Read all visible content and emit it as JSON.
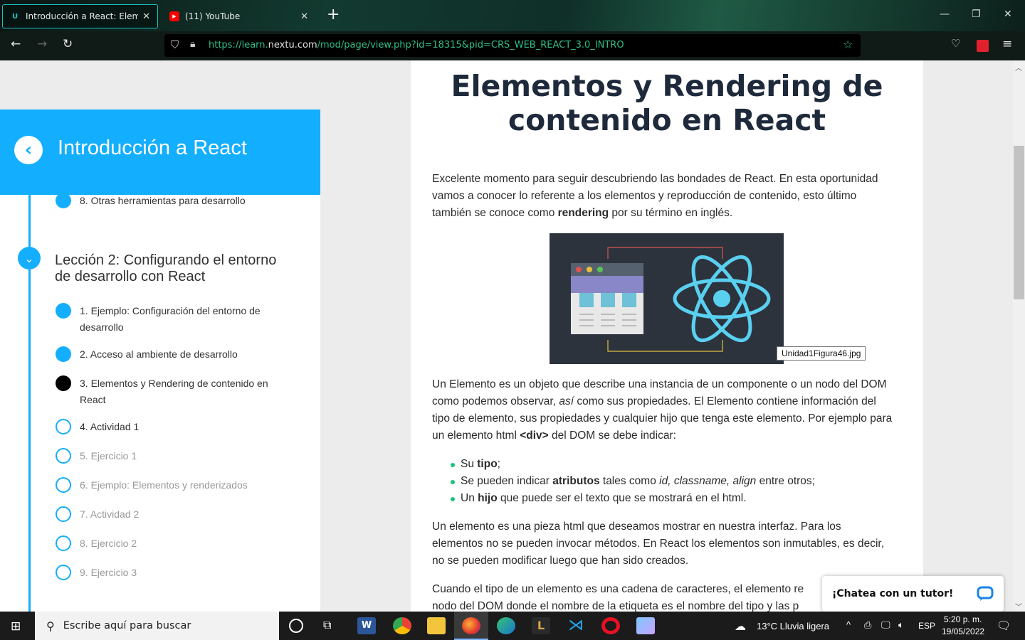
{
  "browser": {
    "tabs": [
      {
        "title": "Introducción a React: Elementos y",
        "favicon": "nextu-icon",
        "active": true
      },
      {
        "title": "(11) YouTube",
        "favicon": "youtube-icon",
        "active": false
      }
    ],
    "url_prefix": "https://learn.",
    "url_domain": "nextu.com",
    "url_path": "/mod/page/view.php?id=18315&pid=CRS_WEB_REACT_3.0_INTRO"
  },
  "sidebar": {
    "title": "Introducción a React",
    "prev_item": "8. Otras herramientas para desarrollo",
    "lesson_title": "Lección 2: Configurando el entorno de desarrollo con React",
    "items": [
      {
        "label": "1. Ejemplo: Configuración del entorno de desarrollo",
        "state": "done"
      },
      {
        "label": "2. Acceso al ambiente de desarrollo",
        "state": "done"
      },
      {
        "label": "3. Elementos y Rendering de contenido en React",
        "state": "current"
      },
      {
        "label": "4. Actividad 1",
        "state": "open"
      },
      {
        "label": "5. Ejercicio 1",
        "state": "locked"
      },
      {
        "label": "6. Ejemplo: Elementos y renderizados",
        "state": "locked"
      },
      {
        "label": "7. Actividad 2",
        "state": "locked"
      },
      {
        "label": "8. Ejercicio 2",
        "state": "locked"
      },
      {
        "label": "9. Ejercicio 3",
        "state": "locked"
      }
    ]
  },
  "content": {
    "title": "Elementos y Rendering de contenido en React",
    "p1a": "Excelente momento para seguir descubriendo las bondades de React. En esta oportunidad vamos a conocer lo referente a los elementos y reproducción de contenido, esto último también se conoce como ",
    "p1b": "rendering",
    "p1c": " por su término en inglés.",
    "figure_tooltip": "Unidad1Figura46.jpg",
    "p2a": "Un Elemento es un objeto que describe una instancia de un componente o un nodo del DOM como podemos observar, ",
    "p2b": "así",
    "p2c": " como sus propiedades. El Elemento contiene información del tipo de elemento, sus propiedades y cualquier hijo que tenga este elemento. Por ejemplo para un elemento html ",
    "p2d": "<div>",
    "p2e": " del DOM se debe indicar:",
    "b1a": "Su ",
    "b1b": "tipo",
    "b1c": ";",
    "b2a": "Se pueden indicar ",
    "b2b": "atributos",
    "b2c": " tales como ",
    "b2d": "id, classname, align",
    "b2e": " entre otros;",
    "b3a": "Un ",
    "b3b": "hijo",
    "b3c": " que puede ser el texto que se mostrará en el html.",
    "p3": "Un elemento es una pieza html  que deseamos mostrar en nuestra interfaz. Para los elementos no se pueden invocar métodos. En React los elementos son inmutables, es decir, no se pueden modificar luego que han sido creados.",
    "p4": "Cuando el tipo de un elemento es una cadena de caracteres, el elemento re",
    "p5": "nodo del DOM donde el nombre de la etiqueta es el nombre del tipo y las p"
  },
  "chat": {
    "label": "¡Chatea con un tutor!"
  },
  "taskbar": {
    "search_placeholder": "Escribe aquí para buscar",
    "weather": "13°C  Lluvia ligera",
    "lang": "ESP",
    "time": "5:20 p. m.",
    "date": "19/05/2022"
  },
  "colors": {
    "accent": "#14aefe",
    "url_green": "#2fbf8a",
    "bullet": "#19c37d"
  }
}
